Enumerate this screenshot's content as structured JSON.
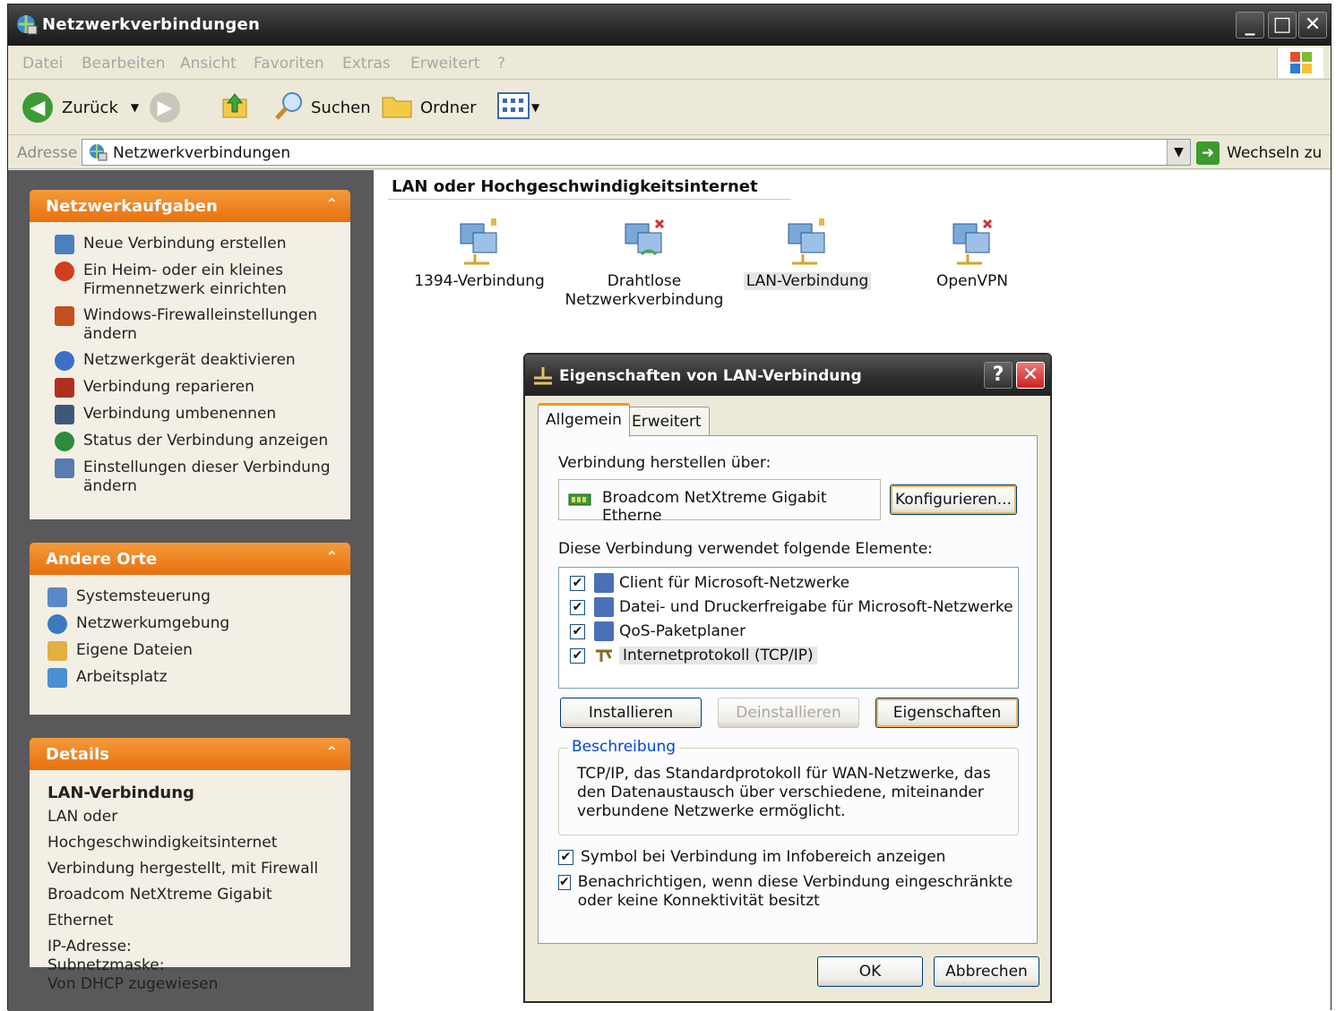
{
  "window": {
    "title": "Netzwerkverbindungen",
    "controls": {
      "minimize": "_",
      "maximize": "□",
      "close": "✕"
    }
  },
  "menu": [
    "Datei",
    "Bearbeiten",
    "Ansicht",
    "Favoriten",
    "Extras",
    "Erweitert",
    "?"
  ],
  "toolbar": {
    "back_label": "Zurück",
    "search_label": "Suchen",
    "folders_label": "Ordner"
  },
  "address": {
    "label": "Adresse",
    "value": "Netzwerkverbindungen",
    "go_label": "Wechseln zu"
  },
  "sidebar": {
    "tasks": {
      "title": "Netzwerkaufgaben",
      "items": [
        {
          "label": "Neue Verbindung erstellen",
          "icon": "new-connection-icon",
          "color": "#4a7fc0"
        },
        {
          "label": "Ein Heim- oder ein kleines Firmennetzwerk einrichten",
          "icon": "home-network-icon",
          "color": "#d04020"
        },
        {
          "label": "Windows-Firewalleinstellungen ändern",
          "icon": "firewall-icon",
          "color": "#c0501c"
        },
        {
          "label": "Netzwerkgerät deaktivieren",
          "icon": "disable-device-icon",
          "color": "#3a70c8"
        },
        {
          "label": "Verbindung reparieren",
          "icon": "repair-icon",
          "color": "#b03020"
        },
        {
          "label": "Verbindung umbenennen",
          "icon": "rename-icon",
          "color": "#405878"
        },
        {
          "label": "Status der Verbindung anzeigen",
          "icon": "status-icon",
          "color": "#2e8a3e"
        },
        {
          "label": "Einstellungen dieser Verbindung ändern",
          "icon": "settings-icon",
          "color": "#5a7ab0"
        }
      ]
    },
    "places": {
      "title": "Andere Orte",
      "items": [
        {
          "label": "Systemsteuerung",
          "icon": "control-panel-icon",
          "color": "#5a88c8"
        },
        {
          "label": "Netzwerkumgebung",
          "icon": "network-places-icon",
          "color": "#3a7ac0"
        },
        {
          "label": "Eigene Dateien",
          "icon": "my-documents-icon",
          "color": "#e0b040"
        },
        {
          "label": "Arbeitsplatz",
          "icon": "my-computer-icon",
          "color": "#4a90d0"
        }
      ]
    },
    "details": {
      "title": "Details",
      "name": "LAN-Verbindung",
      "lines": [
        "LAN oder Hochgeschwindigkeitsinternet",
        "Verbindung hergestellt, mit Firewall",
        "Broadcom NetXtreme Gigabit Ethernet",
        "IP-Adresse:",
        "Subnetzmaske:",
        "Von DHCP zugewiesen"
      ]
    }
  },
  "content": {
    "group_title": "LAN oder Hochgeschwindigkeitsinternet",
    "connections": [
      {
        "label": "1394-Verbindung",
        "icon": "lan-connection-icon"
      },
      {
        "label": "Drahtlose Netzwerkverbindung",
        "icon": "wireless-connection-icon"
      },
      {
        "label": "LAN-Verbindung",
        "icon": "lan-connection-icon"
      },
      {
        "label": "OpenVPN",
        "icon": "disconnected-connection-icon"
      }
    ]
  },
  "dialog": {
    "title": "Eigenschaften von LAN-Verbindung",
    "help": "?",
    "close": "✕",
    "tabs": [
      "Allgemein",
      "Erweitert"
    ],
    "connect_using_label": "Verbindung herstellen über:",
    "adapter": "Broadcom NetXtreme Gigabit Etherne",
    "configure_button": "Konfigurieren...",
    "elements_label": "Diese Verbindung verwendet folgende Elemente:",
    "elements": [
      {
        "label": "Client für Microsoft-Netzwerke",
        "checked": "✔"
      },
      {
        "label": "Datei- und Druckerfreigabe für Microsoft-Netzwerke",
        "checked": "✔"
      },
      {
        "label": "QoS-Paketplaner",
        "checked": "✔"
      },
      {
        "label": "Internetprotokoll (TCP/IP)",
        "checked": "✔"
      }
    ],
    "install_button": "Installieren",
    "uninstall_button": "Deinstallieren",
    "properties_button": "Eigenschaften",
    "description_title": "Beschreibung",
    "description_text": "TCP/IP, das Standardprotokoll für WAN-Netzwerke, das den Datenaustausch über verschiedene, miteinander verbundene Netzwerke ermöglicht.",
    "option_tray": "Symbol bei Verbindung im Infobereich anzeigen",
    "option_notify": "Benachrichtigen, wenn diese Verbindung eingeschränkte oder keine Konnektivität besitzt",
    "ok_button": "OK",
    "cancel_button": "Abbrechen"
  }
}
